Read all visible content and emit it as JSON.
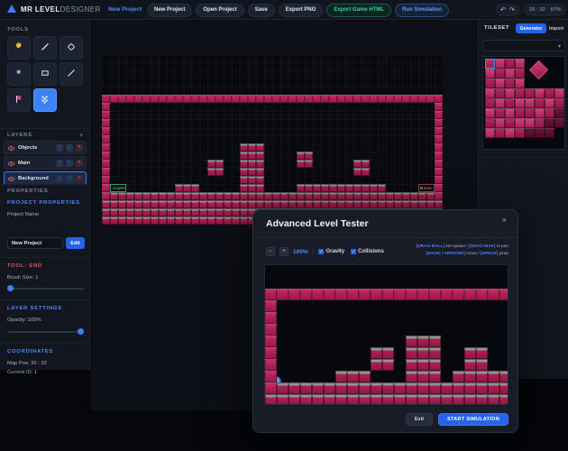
{
  "colors": {
    "accent": "#2563eb",
    "accent_text": "#4c8df6",
    "green": "#31d39c",
    "red": "#e05b5b",
    "tile_pink": "#b11f56",
    "tile_dark": "#8e1746",
    "grass_gray": "#8e978f",
    "ball_blue": "#3f86f7"
  },
  "topbar": {
    "logo_bold": "MR LEVEL",
    "logo_light": "DESIGNER",
    "project_label": "New Project",
    "buttons": [
      "New Project",
      "Open Project",
      "Save",
      "Export PNG"
    ],
    "export_html_label": "Export Game HTML",
    "run_sim_label": "Run Simulation",
    "undo_icon": "↶",
    "redo_icon": "↷",
    "coords": "26 : 32",
    "zoom": "87%"
  },
  "tools": {
    "header": "TOOLS",
    "selected": "end-flag",
    "items": [
      {
        "name": "paint-bucket"
      },
      {
        "name": "pencil"
      },
      {
        "name": "eraser"
      },
      {
        "name": "brush"
      },
      {
        "name": "rectangle"
      },
      {
        "name": "line"
      },
      {
        "name": "start-flag"
      },
      {
        "name": "end-flag"
      }
    ]
  },
  "layers": {
    "header": "LAYERS",
    "add_label": "+",
    "items": [
      {
        "label": "Objects",
        "selected": false
      },
      {
        "label": "Main",
        "selected": false
      },
      {
        "label": "Background",
        "selected": true
      }
    ],
    "row_buttons": [
      "up",
      "down",
      "delete"
    ]
  },
  "properties": {
    "header": "PROPERTIES",
    "subheader": "PROJECT PROPERTIES",
    "name_label": "Project Name",
    "name_value": "New Project",
    "edit_label": "Edit"
  },
  "tool_info": {
    "header": "TOOL: END",
    "brush_label": "Brush Size: 1",
    "brush_value": 1
  },
  "layer_settings": {
    "header": "LAYER SETTINGS",
    "opacity_label": "Opacity: 100%",
    "opacity_value": 100
  },
  "coordinates": {
    "header": "COORDINATES",
    "map_pos": "Map Pos: 26 : 32",
    "current_id": "Current ID: 1"
  },
  "tileset": {
    "header": "TILESET",
    "generator_label": "Generator",
    "import_label": "Import",
    "dropdown_value": "",
    "chevron_icon": "▾",
    "palette_grid": [
      [
        4,
        1,
        2,
        1,
        0,
        0,
        0,
        0
      ],
      [
        1,
        2,
        1,
        2,
        0,
        0,
        0,
        0
      ],
      [
        2,
        1,
        2,
        1,
        0,
        0,
        0,
        0
      ],
      [
        1,
        2,
        1,
        2,
        2,
        1,
        2,
        1
      ],
      [
        2,
        1,
        2,
        1,
        1,
        2,
        1,
        2
      ],
      [
        1,
        2,
        1,
        2,
        2,
        1,
        2,
        3
      ],
      [
        2,
        1,
        2,
        1,
        1,
        2,
        3,
        3
      ],
      [
        1,
        2,
        1,
        2,
        3,
        3,
        3,
        0
      ]
    ]
  },
  "editor_map": {
    "tile_size": 9,
    "rows": [
      "..........................................",
      "..........................................",
      "..........................................",
      "..........................................",
      "..........................................",
      "WWWWWWWWWWWWWWWWWWWWWWWWWWWWWWWWWWWWWWWWWW",
      "W........................................W",
      "W........................................W",
      "W........................................W",
      "W........................................W",
      "W........................................W",
      "W................ggg.....................W",
      "W................ggg....gg...............W",
      "W............gg..ggg....gg.....gg........W",
      "W............gg..ggg...........gg........W",
      "W................ggg.....................W",
      "W........ggg.....ggg....ggggggggggg......W",
      "WggggggggggggggggggggggggggggggggggggggggW",
      "gggggggggggggggggggggggggggggggggggggggggg",
      "gggggggggggggggggggggggggggggggggggggggggg",
      "gggggggggggggggggggggggggggggggggggggggggg"
    ],
    "start": {
      "col": 1,
      "row": 16,
      "span": 2,
      "label": "START"
    },
    "end": {
      "col": 39,
      "row": 16,
      "span": 2,
      "label": "END"
    }
  },
  "modal": {
    "title": "Advanced Level Tester",
    "close_icon": "×",
    "zoom_out": "−",
    "zoom_in": "+",
    "zoom_value": "100%",
    "separator": "|",
    "checkboxes": [
      {
        "label": "Gravity",
        "checked": true
      },
      {
        "label": "Collisions",
        "checked": true
      }
    ],
    "check_icon": "✓",
    "help_line1": [
      {
        "t": "[DRAG BALL]",
        "hl": true
      },
      {
        "t": " set spawn / ",
        "hl": false
      },
      {
        "t": "[DRAG MAP]",
        "hl": true
      },
      {
        "t": " to pan",
        "hl": false
      }
    ],
    "help_line2": [
      {
        "t": "[WASD / ARROWS]",
        "hl": true
      },
      {
        "t": " move / ",
        "hl": false
      },
      {
        "t": "[SPACE]",
        "hl": true
      },
      {
        "t": " jump",
        "hl": false
      }
    ],
    "tester_map": {
      "tile_size": 13,
      "rows": [
        ".....................",
        ".....................",
        "WWWWWWWWWWWWWWWWWWWWW",
        "W....................",
        "W....................",
        "W....................",
        "W...........ggg......",
        "W........gg.ggg..gg..",
        "W........gg.ggg..gg..",
        "W.....ggg...ggg.ggggg",
        "Wgggggggggggggggggggg",
        "ggggggggggggggggggggg",
        "ggggggggggggggggggggg"
      ],
      "ball": {
        "col": 0.55,
        "row": 9.45
      }
    },
    "exit_label": "Exit",
    "start_label": "START SIMULATION"
  }
}
